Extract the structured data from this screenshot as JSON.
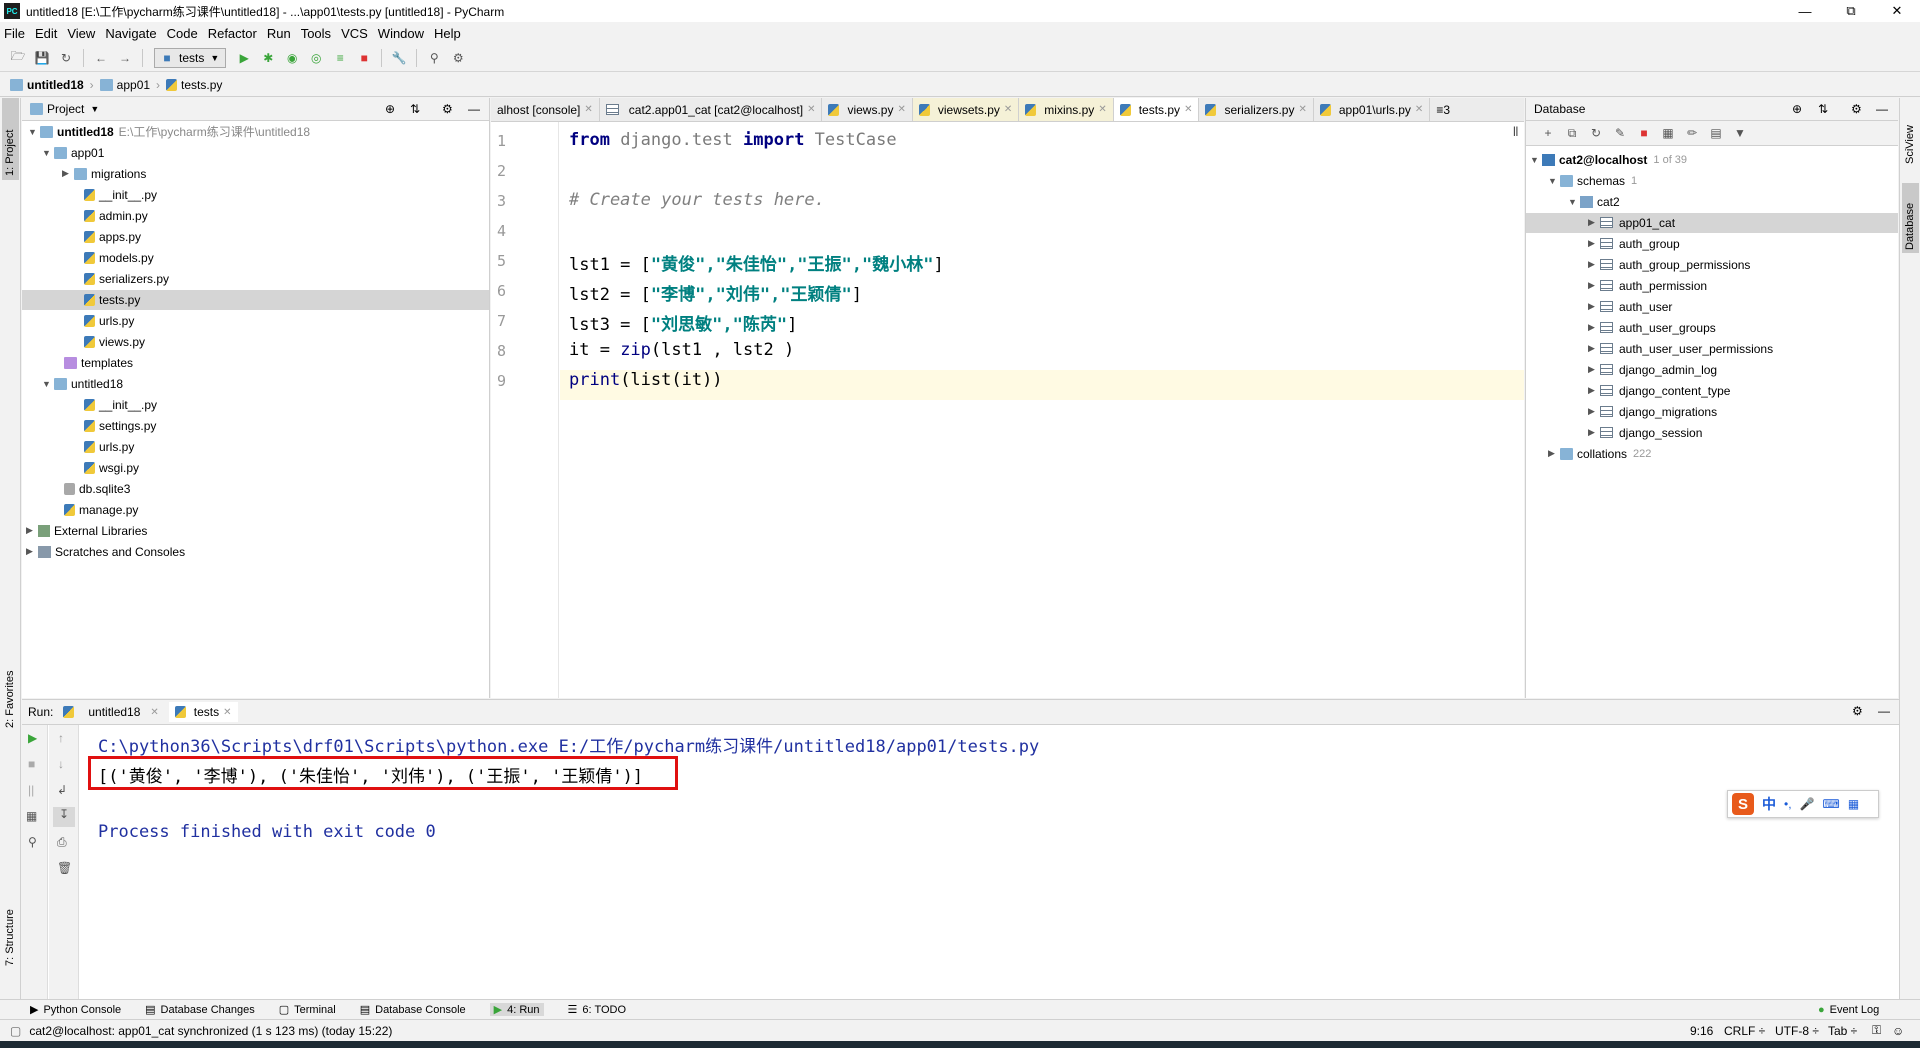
{
  "window": {
    "title": "untitled18 [E:\\工作\\pycharm练习课件\\untitled18] - ...\\app01\\tests.py [untitled18] - PyCharm",
    "app_icon": "PC"
  },
  "menu": [
    "File",
    "Edit",
    "View",
    "Navigate",
    "Code",
    "Refactor",
    "Run",
    "Tools",
    "VCS",
    "Window",
    "Help"
  ],
  "toolbar": {
    "run_config": "tests"
  },
  "breadcrumb": [
    "untitled18",
    "app01",
    "tests.py"
  ],
  "left_stripe": {
    "project": "1: Project",
    "favorites": "2: Favorites",
    "structure": "7: Structure"
  },
  "right_stripe": {
    "sciview": "SciView",
    "database": "Database"
  },
  "project": {
    "header": "Project",
    "root_label": "untitled18",
    "root_path": "E:\\工作\\pycharm练习课件\\untitled18",
    "items": [
      "app01",
      "migrations",
      "__init__.py",
      "admin.py",
      "apps.py",
      "models.py",
      "serializers.py",
      "tests.py",
      "urls.py",
      "views.py",
      "templates",
      "untitled18",
      "__init__.py",
      "settings.py",
      "urls.py",
      "wsgi.py",
      "db.sqlite3",
      "manage.py",
      "External Libraries",
      "Scratches and Consoles"
    ]
  },
  "editor": {
    "tabs": [
      "alhost [console]",
      "cat2.app01_cat [cat2@localhost]",
      "views.py",
      "viewsets.py",
      "mixins.py",
      "tests.py",
      "serializers.py",
      "app01\\urls.py"
    ],
    "tab_overflow": "≡3",
    "line_numbers": [
      "1",
      "2",
      "3",
      "4",
      "5",
      "6",
      "7",
      "8",
      "9"
    ],
    "code": {
      "l1_kw1": "from",
      "l1_mod": " django.test ",
      "l1_kw2": "import",
      "l1_rest": " TestCase",
      "l3": "# Create your tests here.",
      "l5_pre": "lst1 = [",
      "l5_str": "\"黄俊\",\"朱佳怡\",\"王振\",\"魏小林\"",
      "l5_post": "]",
      "l6_pre": "lst2 = [",
      "l6_str": "\"李博\",\"刘伟\",\"王颖倩\"",
      "l6_post": "]",
      "l7_pre": "lst3 = [",
      "l7_str": "\"刘思敏\",\"陈芮\"",
      "l7_post": "]",
      "l8_pre": "it = ",
      "l8_fn": "zip",
      "l8_post": "(lst1 , lst2 )",
      "l9_fn": "print",
      "l9_rest": "(list(it))"
    }
  },
  "database": {
    "header": "Database",
    "connection": "cat2@localhost",
    "connection_count": "1 of 39",
    "schemas_label": "schemas",
    "schemas_count": "1",
    "schema": "cat2",
    "tables": [
      "app01_cat",
      "auth_group",
      "auth_group_permissions",
      "auth_permission",
      "auth_user",
      "auth_user_groups",
      "auth_user_user_permissions",
      "django_admin_log",
      "django_content_type",
      "django_migrations",
      "django_session"
    ],
    "collations_label": "collations",
    "collations_count": "222"
  },
  "run": {
    "label": "Run:",
    "tabs": [
      "untitled18",
      "tests"
    ],
    "command": "C:\\python36\\Scripts\\drf01\\Scripts\\python.exe E:/工作/pycharm练习课件/untitled18/app01/tests.py",
    "output": "[('黄俊', '李博'), ('朱佳怡', '刘伟'), ('王振', '王颖倩')]",
    "finished": "Process finished with exit code 0"
  },
  "ime": {
    "logo": "S",
    "lang": "中",
    "punct": "•,",
    "icons": [
      "mic-icon",
      "keyboard-icon",
      "grid-icon"
    ]
  },
  "bottom_tabs": [
    "Python Console",
    "Database Changes",
    "Terminal",
    "Database Console",
    "4: Run",
    "6: TODO"
  ],
  "event_log": "Event Log",
  "status": {
    "message": "cat2@localhost: app01_cat synchronized (1 s 123 ms) (today 15:22)",
    "position": "9:16",
    "line_sep": "CRLF ÷",
    "encoding": "UTF-8 ÷",
    "indent": "Tab ÷"
  },
  "colors": {
    "highlight_box": "#e01010",
    "console_blue": "#2030a0",
    "string": "#008080",
    "keyword": "#000080"
  }
}
